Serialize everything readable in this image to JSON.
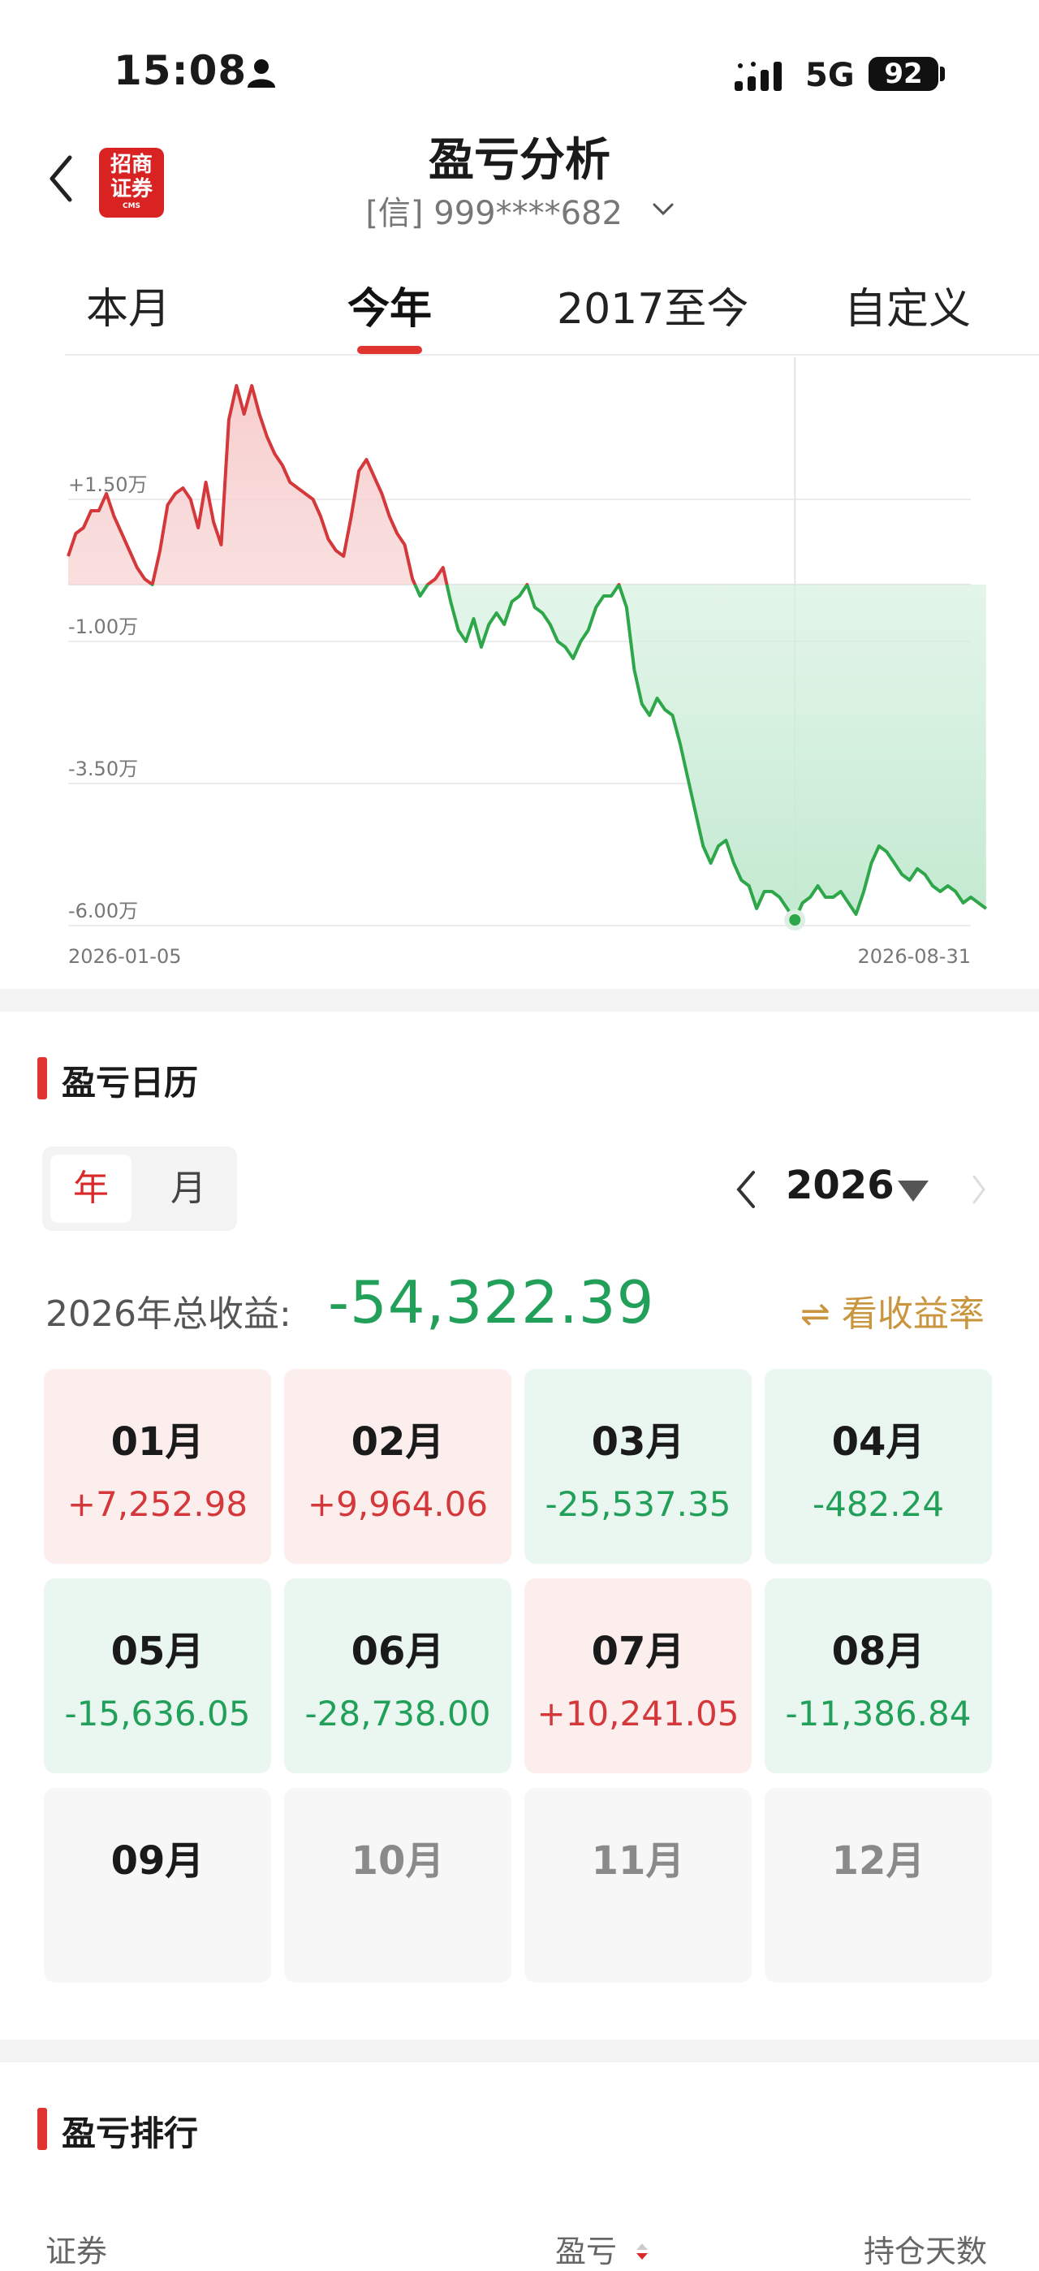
{
  "status": {
    "time": "15:08",
    "network": "5G",
    "battery": "92"
  },
  "header": {
    "title": "盈亏分析",
    "account": "[信] 999****682",
    "broker_logo": {
      "line1": "招商",
      "line2": "证券",
      "line3": "CMS"
    }
  },
  "tabs": [
    {
      "label": "本月",
      "active": false
    },
    {
      "label": "今年",
      "active": true
    },
    {
      "label": "2017至今",
      "active": false
    },
    {
      "label": "自定义",
      "active": false
    }
  ],
  "chart_data": {
    "type": "area",
    "y_ticks": [
      "+1.50万",
      "-1.00万",
      "-3.50万",
      "-6.00万"
    ],
    "x_labels": [
      "2026-01-05",
      "2026-08-31"
    ],
    "ylim": [
      -6.0,
      4.0
    ],
    "unit": "万",
    "colors": {
      "positive": "#d4383a",
      "negative": "#2ea64a"
    },
    "series": [
      {
        "values": [
          0.5,
          0.9,
          1.0,
          1.3,
          1.3,
          1.6,
          1.2,
          0.9,
          0.6,
          0.3,
          0.1,
          0.0,
          0.6,
          1.4,
          1.6,
          1.7,
          1.5,
          1.0,
          1.8,
          1.1,
          0.7,
          2.9,
          3.5,
          3.0,
          3.5,
          3.0,
          2.6,
          2.3,
          2.1,
          1.8,
          1.7,
          1.6,
          1.5,
          1.2,
          0.8,
          0.6,
          0.5,
          1.2,
          2.0,
          2.2,
          1.9,
          1.6,
          1.2,
          0.9,
          0.7,
          0.1,
          -0.2,
          0.0,
          0.1,
          0.3,
          -0.3,
          -0.8,
          -1.0,
          -0.6,
          -1.1,
          -0.7,
          -0.5,
          -0.7,
          -0.3,
          -0.2,
          0.0,
          -0.4,
          -0.5,
          -0.7,
          -1.0,
          -1.1,
          -1.3,
          -1.0,
          -0.8,
          -0.4,
          -0.2,
          -0.2,
          0.0,
          -0.4,
          -1.5,
          -2.1,
          -2.3,
          -2.0,
          -2.2,
          -2.3,
          -2.8,
          -3.4,
          -4.0,
          -4.6,
          -4.9,
          -4.6,
          -4.5,
          -4.9,
          -5.2,
          -5.3,
          -5.7,
          -5.4,
          -5.4,
          -5.5,
          -5.7,
          -5.9,
          -5.6,
          -5.5,
          -5.3,
          -5.5,
          -5.5,
          -5.4,
          -5.6,
          -5.8,
          -5.4,
          -4.9,
          -4.6,
          -4.7,
          -4.9,
          -5.1,
          -5.2,
          -5.0,
          -5.1,
          -5.3,
          -5.4,
          -5.3,
          -5.4,
          -5.6,
          -5.5,
          -5.6,
          -5.7
        ]
      }
    ],
    "marker": {
      "index": 95,
      "value": -5.9,
      "color": "#2ea64a"
    }
  },
  "calendar": {
    "section_title": "盈亏日历",
    "toggle": {
      "year": "年",
      "month": "月",
      "active": "year"
    },
    "year": "2026",
    "total_label": "2026年总收益:",
    "total_value": "-54,322.39",
    "rate_link": "⇌ 看收益率",
    "months": [
      {
        "label": "01月",
        "value": "+7,252.98",
        "state": "up"
      },
      {
        "label": "02月",
        "value": "+9,964.06",
        "state": "up"
      },
      {
        "label": "03月",
        "value": "-25,537.35",
        "state": "down"
      },
      {
        "label": "04月",
        "value": "-482.24",
        "state": "down"
      },
      {
        "label": "05月",
        "value": "-15,636.05",
        "state": "down"
      },
      {
        "label": "06月",
        "value": "-28,738.00",
        "state": "down"
      },
      {
        "label": "07月",
        "value": "+10,241.05",
        "state": "up"
      },
      {
        "label": "08月",
        "value": "-11,386.84",
        "state": "down"
      },
      {
        "label": "09月",
        "value": "",
        "state": "none"
      },
      {
        "label": "10月",
        "value": "",
        "state": "future"
      },
      {
        "label": "11月",
        "value": "",
        "state": "future"
      },
      {
        "label": "12月",
        "value": "",
        "state": "future"
      }
    ]
  },
  "ranking": {
    "section_title": "盈亏排行",
    "columns": {
      "security": "证券",
      "pnl": "盈亏",
      "days": "持仓天数"
    }
  }
}
